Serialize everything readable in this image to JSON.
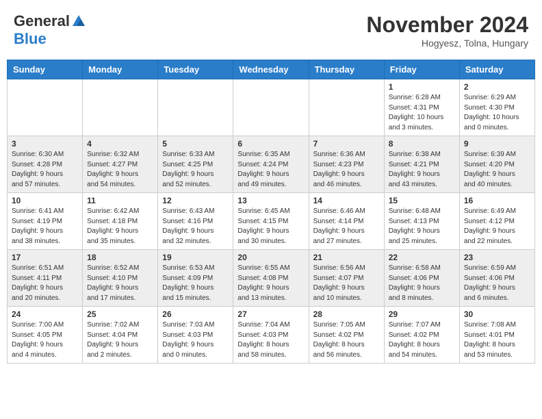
{
  "header": {
    "logo_general": "General",
    "logo_blue": "Blue",
    "month_title": "November 2024",
    "subtitle": "Hogyesz, Tolna, Hungary"
  },
  "weekdays": [
    "Sunday",
    "Monday",
    "Tuesday",
    "Wednesday",
    "Thursday",
    "Friday",
    "Saturday"
  ],
  "weeks": [
    {
      "days": [
        {
          "num": "",
          "info": ""
        },
        {
          "num": "",
          "info": ""
        },
        {
          "num": "",
          "info": ""
        },
        {
          "num": "",
          "info": ""
        },
        {
          "num": "",
          "info": ""
        },
        {
          "num": "1",
          "info": "Sunrise: 6:28 AM\nSunset: 4:31 PM\nDaylight: 10 hours\nand 3 minutes."
        },
        {
          "num": "2",
          "info": "Sunrise: 6:29 AM\nSunset: 4:30 PM\nDaylight: 10 hours\nand 0 minutes."
        }
      ]
    },
    {
      "days": [
        {
          "num": "3",
          "info": "Sunrise: 6:30 AM\nSunset: 4:28 PM\nDaylight: 9 hours\nand 57 minutes."
        },
        {
          "num": "4",
          "info": "Sunrise: 6:32 AM\nSunset: 4:27 PM\nDaylight: 9 hours\nand 54 minutes."
        },
        {
          "num": "5",
          "info": "Sunrise: 6:33 AM\nSunset: 4:25 PM\nDaylight: 9 hours\nand 52 minutes."
        },
        {
          "num": "6",
          "info": "Sunrise: 6:35 AM\nSunset: 4:24 PM\nDaylight: 9 hours\nand 49 minutes."
        },
        {
          "num": "7",
          "info": "Sunrise: 6:36 AM\nSunset: 4:23 PM\nDaylight: 9 hours\nand 46 minutes."
        },
        {
          "num": "8",
          "info": "Sunrise: 6:38 AM\nSunset: 4:21 PM\nDaylight: 9 hours\nand 43 minutes."
        },
        {
          "num": "9",
          "info": "Sunrise: 6:39 AM\nSunset: 4:20 PM\nDaylight: 9 hours\nand 40 minutes."
        }
      ]
    },
    {
      "days": [
        {
          "num": "10",
          "info": "Sunrise: 6:41 AM\nSunset: 4:19 PM\nDaylight: 9 hours\nand 38 minutes."
        },
        {
          "num": "11",
          "info": "Sunrise: 6:42 AM\nSunset: 4:18 PM\nDaylight: 9 hours\nand 35 minutes."
        },
        {
          "num": "12",
          "info": "Sunrise: 6:43 AM\nSunset: 4:16 PM\nDaylight: 9 hours\nand 32 minutes."
        },
        {
          "num": "13",
          "info": "Sunrise: 6:45 AM\nSunset: 4:15 PM\nDaylight: 9 hours\nand 30 minutes."
        },
        {
          "num": "14",
          "info": "Sunrise: 6:46 AM\nSunset: 4:14 PM\nDaylight: 9 hours\nand 27 minutes."
        },
        {
          "num": "15",
          "info": "Sunrise: 6:48 AM\nSunset: 4:13 PM\nDaylight: 9 hours\nand 25 minutes."
        },
        {
          "num": "16",
          "info": "Sunrise: 6:49 AM\nSunset: 4:12 PM\nDaylight: 9 hours\nand 22 minutes."
        }
      ]
    },
    {
      "days": [
        {
          "num": "17",
          "info": "Sunrise: 6:51 AM\nSunset: 4:11 PM\nDaylight: 9 hours\nand 20 minutes."
        },
        {
          "num": "18",
          "info": "Sunrise: 6:52 AM\nSunset: 4:10 PM\nDaylight: 9 hours\nand 17 minutes."
        },
        {
          "num": "19",
          "info": "Sunrise: 6:53 AM\nSunset: 4:09 PM\nDaylight: 9 hours\nand 15 minutes."
        },
        {
          "num": "20",
          "info": "Sunrise: 6:55 AM\nSunset: 4:08 PM\nDaylight: 9 hours\nand 13 minutes."
        },
        {
          "num": "21",
          "info": "Sunrise: 6:56 AM\nSunset: 4:07 PM\nDaylight: 9 hours\nand 10 minutes."
        },
        {
          "num": "22",
          "info": "Sunrise: 6:58 AM\nSunset: 4:06 PM\nDaylight: 9 hours\nand 8 minutes."
        },
        {
          "num": "23",
          "info": "Sunrise: 6:59 AM\nSunset: 4:06 PM\nDaylight: 9 hours\nand 6 minutes."
        }
      ]
    },
    {
      "days": [
        {
          "num": "24",
          "info": "Sunrise: 7:00 AM\nSunset: 4:05 PM\nDaylight: 9 hours\nand 4 minutes."
        },
        {
          "num": "25",
          "info": "Sunrise: 7:02 AM\nSunset: 4:04 PM\nDaylight: 9 hours\nand 2 minutes."
        },
        {
          "num": "26",
          "info": "Sunrise: 7:03 AM\nSunset: 4:03 PM\nDaylight: 9 hours\nand 0 minutes."
        },
        {
          "num": "27",
          "info": "Sunrise: 7:04 AM\nSunset: 4:03 PM\nDaylight: 8 hours\nand 58 minutes."
        },
        {
          "num": "28",
          "info": "Sunrise: 7:05 AM\nSunset: 4:02 PM\nDaylight: 8 hours\nand 56 minutes."
        },
        {
          "num": "29",
          "info": "Sunrise: 7:07 AM\nSunset: 4:02 PM\nDaylight: 8 hours\nand 54 minutes."
        },
        {
          "num": "30",
          "info": "Sunrise: 7:08 AM\nSunset: 4:01 PM\nDaylight: 8 hours\nand 53 minutes."
        }
      ]
    }
  ]
}
